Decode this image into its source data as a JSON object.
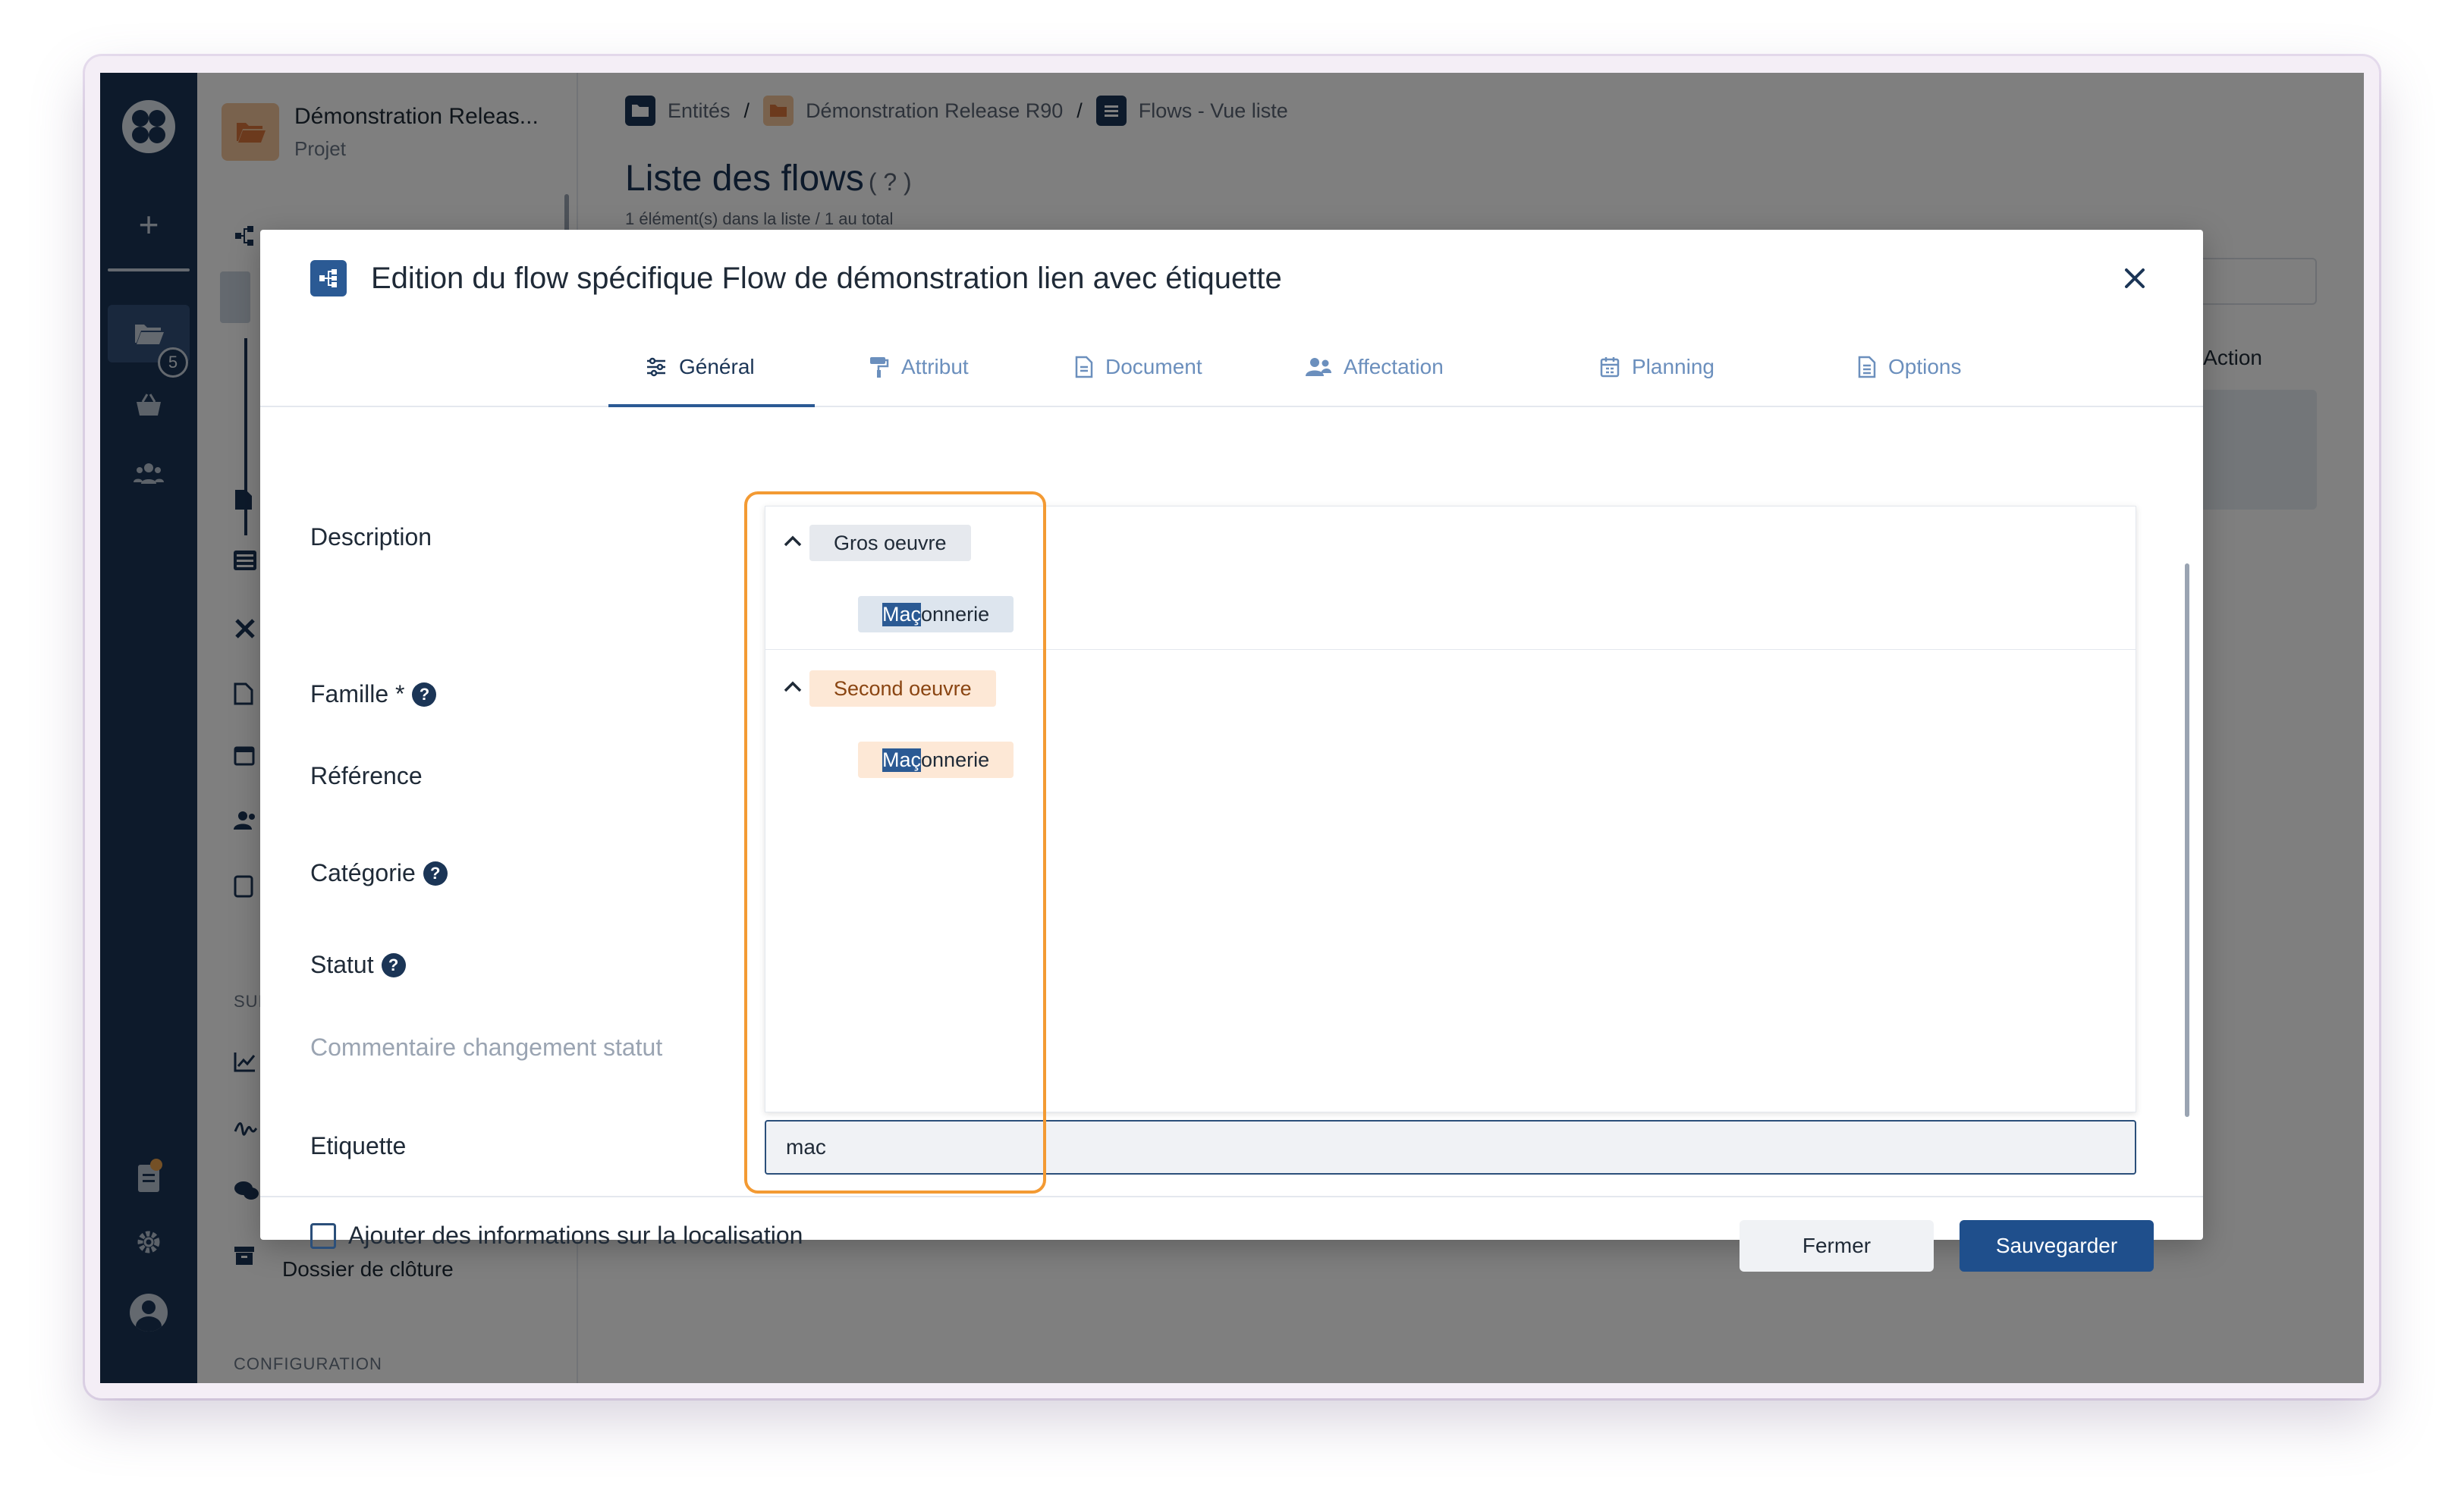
{
  "rail": {
    "folder_badge": "5"
  },
  "sidebar": {
    "project_title": "Démonstration Releas...",
    "project_subtitle": "Projet",
    "closure_folder": "Dossier de clôture",
    "section_sui": "SUI",
    "section_config": "CONFIGURATION"
  },
  "breadcrumb": {
    "items": [
      "Entités",
      "Démonstration Release R90",
      "Flows - Vue liste"
    ],
    "separator": "/"
  },
  "page": {
    "title": "Liste des flows",
    "help": "( ? )",
    "subtitle": "1 élément(s) dans la liste / 1 au total",
    "action_header": "Action"
  },
  "modal": {
    "title": "Edition du flow spécifique Flow de démonstration lien avec étiquette",
    "tabs": [
      {
        "label": "Général",
        "icon": "sliders-icon"
      },
      {
        "label": "Attribut",
        "icon": "paint-roller-icon"
      },
      {
        "label": "Document",
        "icon": "document-icon"
      },
      {
        "label": "Affectation",
        "icon": "users-icon"
      },
      {
        "label": "Planning",
        "icon": "calendar-icon"
      },
      {
        "label": "Options",
        "icon": "options-document-icon"
      }
    ],
    "active_tab": "Général",
    "labels": {
      "description": "Description",
      "famille": "Famille *",
      "reference": "Référence",
      "categorie": "Catégorie",
      "statut": "Statut",
      "commentaire": "Commentaire changement statut",
      "etiquette": "Etiquette"
    },
    "dropdown": {
      "groups": [
        {
          "name": "Gros oeuvre",
          "match": "Maç",
          "rest": "onnerie",
          "color": "#e6e9ee"
        },
        {
          "name": "Second oeuvre",
          "match": "Maç",
          "rest": "onnerie",
          "color": "#fde8d6"
        }
      ]
    },
    "etiquette_value": "mac",
    "footer": {
      "location_checkbox": "Ajouter des informations sur la localisation",
      "close_button": "Fermer",
      "save_button": "Sauvegarder"
    }
  },
  "colors": {
    "rail": "#1b3556",
    "accent": "#2b5a94",
    "highlight_box": "#f39a33",
    "save_button": "#1f4f8c"
  }
}
